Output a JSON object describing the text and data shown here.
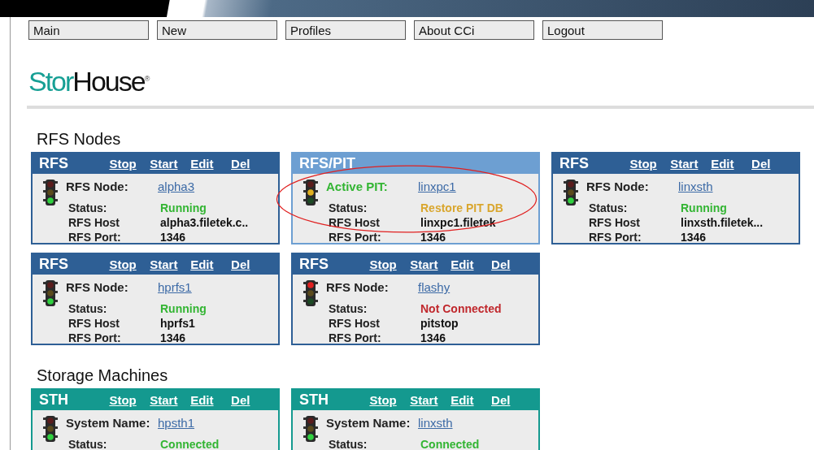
{
  "nav": [
    {
      "label": "Main"
    },
    {
      "label": "New"
    },
    {
      "label": "Profiles"
    },
    {
      "label": "About CCi"
    },
    {
      "label": "Logout"
    }
  ],
  "logo": {
    "first": "Stor",
    "second": "House",
    "mark": "®"
  },
  "sections": [
    {
      "title": "RFS Nodes",
      "cards": [
        {
          "kind": "rfs",
          "title": "RFS",
          "actions": [
            "Stop",
            "Start",
            "Edit",
            "Del"
          ],
          "lamps": {
            "red": false,
            "yellow": false,
            "green": true
          },
          "fields": [
            {
              "kind": "link",
              "label": "RFS Node:",
              "value": "alpha3"
            },
            {
              "kind": "text",
              "label": "Status:",
              "value": "Running",
              "color": "#33b533"
            },
            {
              "kind": "text",
              "label": "RFS Host",
              "value": "alpha3.filetek.c.."
            },
            {
              "kind": "text",
              "label": "RFS Port:",
              "value": "1346"
            }
          ]
        },
        {
          "kind": "pit",
          "title": "RFS/PIT",
          "lamps": {
            "red": false,
            "yellow": true,
            "green": false
          },
          "fields": [
            {
              "kind": "link",
              "label": "Active PIT:",
              "value": "linxpc1"
            },
            {
              "kind": "text",
              "label": "Status:",
              "value": "Restore PIT DB",
              "color": "#d9a62e"
            },
            {
              "kind": "text",
              "label": "RFS Host",
              "value": "linxpc1.filetek"
            },
            {
              "kind": "text",
              "label": "RFS Port:",
              "value": "1346"
            }
          ]
        },
        {
          "kind": "rfs",
          "title": "RFS",
          "actions": [
            "Stop",
            "Start",
            "Edit",
            "Del"
          ],
          "lamps": {
            "red": false,
            "yellow": false,
            "green": true
          },
          "fields": [
            {
              "kind": "link",
              "label": "RFS Node:",
              "value": "linxsth"
            },
            {
              "kind": "text",
              "label": "Status:",
              "value": "Running",
              "color": "#33b533"
            },
            {
              "kind": "text",
              "label": "RFS Host",
              "value": "linxsth.filetek..."
            },
            {
              "kind": "text",
              "label": "RFS Port:",
              "value": "1346"
            }
          ]
        },
        {
          "kind": "rfs",
          "title": "RFS",
          "actions": [
            "Stop",
            "Start",
            "Edit",
            "Del"
          ],
          "lamps": {
            "red": false,
            "yellow": false,
            "green": true
          },
          "fields": [
            {
              "kind": "link",
              "label": "RFS Node:",
              "value": "hprfs1"
            },
            {
              "kind": "text",
              "label": "Status:",
              "value": "Running",
              "color": "#33b533"
            },
            {
              "kind": "text",
              "label": "RFS Host",
              "value": "hprfs1"
            },
            {
              "kind": "text",
              "label": "RFS Port:",
              "value": "1346"
            }
          ]
        },
        {
          "kind": "rfs",
          "title": "RFS",
          "actions": [
            "Stop",
            "Start",
            "Edit",
            "Del"
          ],
          "lamps": {
            "red": true,
            "yellow": false,
            "green": false
          },
          "fields": [
            {
              "kind": "link",
              "label": "RFS Node:",
              "value": "flashy"
            },
            {
              "kind": "text",
              "label": "Status:",
              "value": "Not Connected",
              "color": "#c0282d"
            },
            {
              "kind": "text",
              "label": "RFS Host",
              "value": "pitstop"
            },
            {
              "kind": "text",
              "label": "RFS Port:",
              "value": "1346"
            }
          ]
        }
      ]
    },
    {
      "title": "Storage Machines",
      "cards": [
        {
          "kind": "sth",
          "title": "STH",
          "actions": [
            "Stop",
            "Start",
            "Edit",
            "Del"
          ],
          "lamps": {
            "red": false,
            "yellow": false,
            "green": true
          },
          "fields": [
            {
              "kind": "link",
              "label": "System Name:",
              "value": "hpsth1"
            },
            {
              "kind": "text",
              "label": "Status:",
              "value": "Connected",
              "color": "#33b533"
            }
          ]
        },
        {
          "kind": "sth",
          "title": "STH",
          "actions": [
            "Stop",
            "Start",
            "Edit",
            "Del"
          ],
          "lamps": {
            "red": false,
            "yellow": false,
            "green": true
          },
          "fields": [
            {
              "kind": "link",
              "label": "System Name:",
              "value": "linxsth"
            },
            {
              "kind": "text",
              "label": "Status:",
              "value": "Connected",
              "color": "#33b533"
            }
          ]
        }
      ]
    }
  ]
}
